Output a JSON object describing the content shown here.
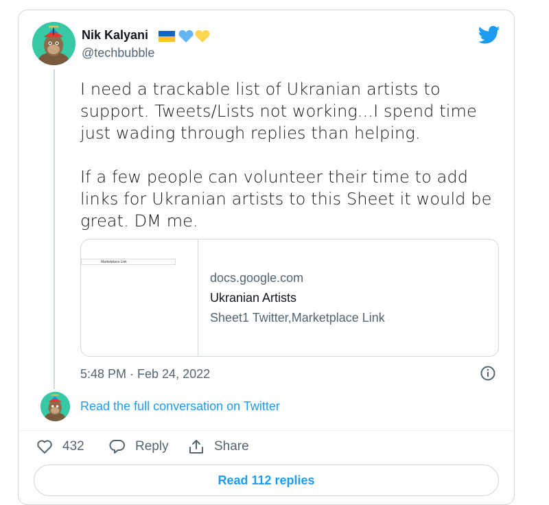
{
  "author": {
    "name": "Nik Kalyani",
    "handle": "@techbubble",
    "name_emojis": [
      "ukraine-flag-icon",
      "blue-heart-icon",
      "yellow-heart-icon"
    ]
  },
  "tweet": {
    "text": "I need a trackable list of Ukranian artists to support. Tweets/Lists not working...I spend time just wading through replies than helping.\n\nIf a few people can volunteer their time to add links for Ukranian artists to this Sheet it would be great. DM me.",
    "timestamp": "5:48 PM · Feb 24, 2022"
  },
  "link_card": {
    "thumbnail_text": "Marketplace Link",
    "domain": "docs.google.com",
    "title": "Ukranian Artists",
    "description": "Sheet1 Twitter,Marketplace Link"
  },
  "conversation_link": "Read the full conversation on Twitter",
  "actions": {
    "like_count": "432",
    "reply_label": "Reply",
    "share_label": "Share"
  },
  "replies_button": "Read 112 replies",
  "colors": {
    "twitter_blue": "#1d9bf0",
    "secondary_text": "#536471",
    "border": "#cfd9de",
    "avatar_bg": "#36c9a4"
  }
}
